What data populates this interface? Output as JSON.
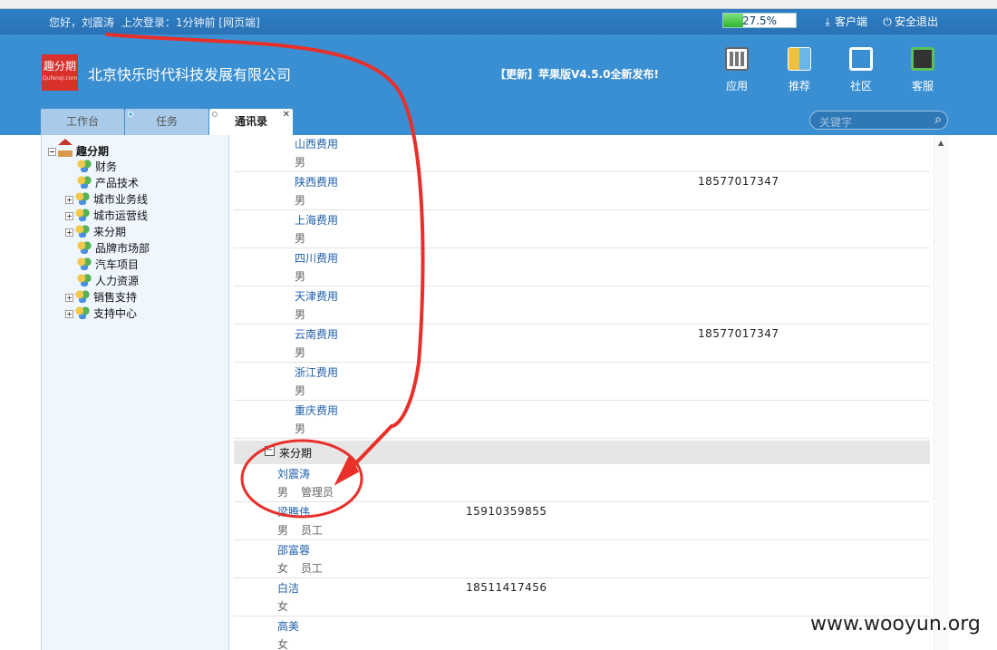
{
  "userbar": {
    "greeting": "您好，刘震涛",
    "last_login": "上次登录：1分钟前 [网页端]",
    "progress_text": "27.5%",
    "progress_value": 0.275,
    "client": "客户端",
    "logout": "安全退出"
  },
  "header": {
    "logo_text": "趣分期",
    "logo_sub": "Qufenqi.com",
    "company": "北京快乐时代科技发展有限公司",
    "notice": "【更新】苹果版V4.5.0全新发布!",
    "icons": [
      {
        "label": "应用",
        "icon": "apps-icon"
      },
      {
        "label": "推荐",
        "icon": "recommend-icon"
      },
      {
        "label": "社区",
        "icon": "community-icon"
      },
      {
        "label": "客服",
        "icon": "support-icon"
      }
    ]
  },
  "tabs": [
    {
      "label": "工作台"
    },
    {
      "label": "任务"
    },
    {
      "label": "通讯录"
    }
  ],
  "search": {
    "placeholder": "关键字"
  },
  "tree": {
    "root": "趣分期",
    "items": [
      {
        "label": "财务",
        "expandable": false
      },
      {
        "label": "产品技术",
        "expandable": false
      },
      {
        "label": "城市业务线",
        "expandable": true
      },
      {
        "label": "城市运营线",
        "expandable": true
      },
      {
        "label": "来分期",
        "expandable": true
      },
      {
        "label": "品牌市场部",
        "expandable": false
      },
      {
        "label": "汽车项目",
        "expandable": false
      },
      {
        "label": "人力资源",
        "expandable": false
      },
      {
        "label": "销售支持",
        "expandable": true
      },
      {
        "label": "支持中心",
        "expandable": true
      }
    ]
  },
  "contacts_top": [
    {
      "name": "山西费用",
      "gender": "男",
      "phone": ""
    },
    {
      "name": "陕西费用",
      "gender": "男",
      "phone": "18577017347"
    },
    {
      "name": "上海费用",
      "gender": "男",
      "phone": ""
    },
    {
      "name": "四川费用",
      "gender": "男",
      "phone": ""
    },
    {
      "name": "天津费用",
      "gender": "男",
      "phone": ""
    },
    {
      "name": "云南费用",
      "gender": "男",
      "phone": "18577017347"
    },
    {
      "name": "浙江费用",
      "gender": "男",
      "phone": ""
    },
    {
      "name": "重庆费用",
      "gender": "男",
      "phone": ""
    }
  ],
  "group": {
    "label": "来分期",
    "toggle": "−",
    "contacts": [
      {
        "name": "刘震涛",
        "gender": "男",
        "role": "管理员",
        "phone": ""
      },
      {
        "name": "梁腾伟",
        "gender": "男",
        "role": "员工",
        "phone": "15910359855"
      },
      {
        "name": "邵富蓉",
        "gender": "女",
        "role": "员工",
        "phone": ""
      },
      {
        "name": "白洁",
        "gender": "女",
        "role": "",
        "phone": "18511417456"
      },
      {
        "name": "高美",
        "gender": "女",
        "role": "",
        "phone": ""
      }
    ]
  },
  "watermark": "www.wooyun.org",
  "colors": {
    "header_bg": "#3a8fd3",
    "annotation": "#e8302a",
    "link": "#1e5fa8"
  }
}
